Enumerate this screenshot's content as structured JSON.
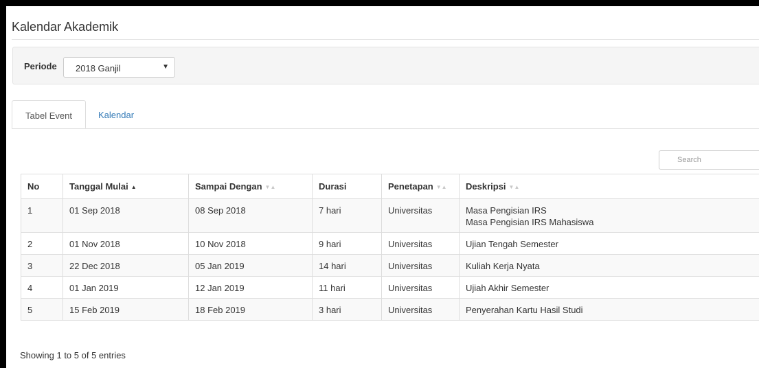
{
  "page": {
    "title": "Kalendar Akademik"
  },
  "filter": {
    "label": "Periode",
    "selected": "2018 Ganjil"
  },
  "tabs": [
    {
      "label": "Tabel Event",
      "active": true
    },
    {
      "label": "Kalendar",
      "active": false
    }
  ],
  "search": {
    "placeholder": "Search",
    "value": ""
  },
  "table": {
    "columns": [
      {
        "label": "No",
        "sort": "none"
      },
      {
        "label": "Tanggal Mulai",
        "sort": "asc"
      },
      {
        "label": "Sampai Dengan",
        "sort": "both"
      },
      {
        "label": "Durasi",
        "sort": "none"
      },
      {
        "label": "Penetapan",
        "sort": "both"
      },
      {
        "label": "Deskripsi",
        "sort": "both"
      }
    ],
    "rows": [
      {
        "no": "1",
        "start": "01 Sep 2018",
        "end": "08 Sep 2018",
        "duration": "7 hari",
        "level": "Universitas",
        "desc": [
          "Masa Pengisian IRS",
          "Masa Pengisian IRS Mahasiswa"
        ]
      },
      {
        "no": "2",
        "start": "01 Nov 2018",
        "end": "10 Nov 2018",
        "duration": "9 hari",
        "level": "Universitas",
        "desc": [
          "Ujian Tengah Semester"
        ]
      },
      {
        "no": "3",
        "start": "22 Dec 2018",
        "end": "05 Jan 2019",
        "duration": "14 hari",
        "level": "Universitas",
        "desc": [
          "Kuliah Kerja Nyata"
        ]
      },
      {
        "no": "4",
        "start": "01 Jan 2019",
        "end": "12 Jan 2019",
        "duration": "11 hari",
        "level": "Universitas",
        "desc": [
          "Ujiah Akhir Semester"
        ]
      },
      {
        "no": "5",
        "start": "15 Feb 2019",
        "end": "18 Feb 2019",
        "duration": "3 hari",
        "level": "Universitas",
        "desc": [
          "Penyerahan Kartu Hasil Studi"
        ]
      }
    ]
  },
  "info": "Showing 1 to 5 of 5 entries"
}
